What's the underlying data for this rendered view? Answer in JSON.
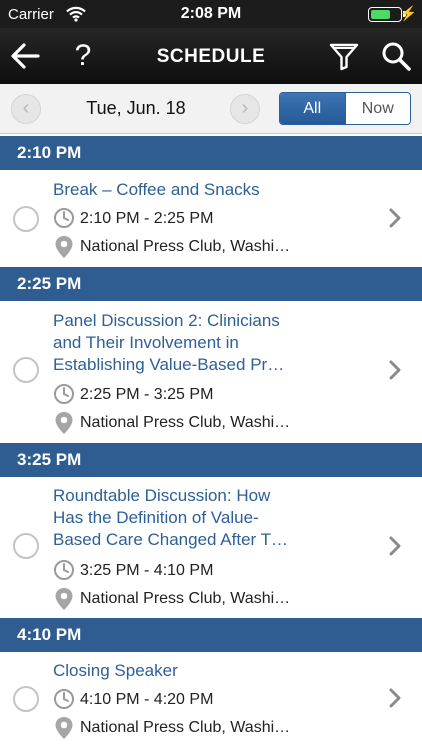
{
  "status_bar": {
    "carrier": "Carrier",
    "time": "2:08 PM",
    "battery_level": 0.7
  },
  "nav": {
    "title": "SCHEDULE",
    "help_label": "?"
  },
  "date_bar": {
    "date": "Tue, Jun. 18",
    "prev_glyph": "‹",
    "next_glyph": "›",
    "filter_all": "All",
    "filter_now": "Now",
    "active_filter": "All"
  },
  "colors": {
    "header_blue": "#2f5d91",
    "link_blue": "#2d5f98",
    "nav_black": "#1a1a1a"
  },
  "sections": [
    {
      "header": "2:10 PM",
      "items": [
        {
          "title_lines": [
            "Break – Coffee and Snacks"
          ],
          "time": "2:10 PM - 2:25 PM",
          "location": "National Press Club, Washi…"
        }
      ]
    },
    {
      "header": "2:25 PM",
      "items": [
        {
          "title_lines": [
            "Panel Discussion 2: Clinicians",
            "and Their Involvement in",
            "Establishing Value-Based Pr…"
          ],
          "time": "2:25 PM - 3:25 PM",
          "location": "National Press Club, Washi…"
        }
      ]
    },
    {
      "header": "3:25 PM",
      "items": [
        {
          "title_lines": [
            "Roundtable Discussion: How",
            "Has the Definition of Value-",
            "Based Care Changed After T…"
          ],
          "time": "3:25 PM - 4:10 PM",
          "location": "National Press Club, Washi…"
        }
      ]
    },
    {
      "header": "4:10 PM",
      "items": [
        {
          "title_lines": [
            "Closing Speaker"
          ],
          "time": "4:10 PM - 4:20 PM",
          "location": "National Press Club, Washi…"
        }
      ]
    }
  ]
}
